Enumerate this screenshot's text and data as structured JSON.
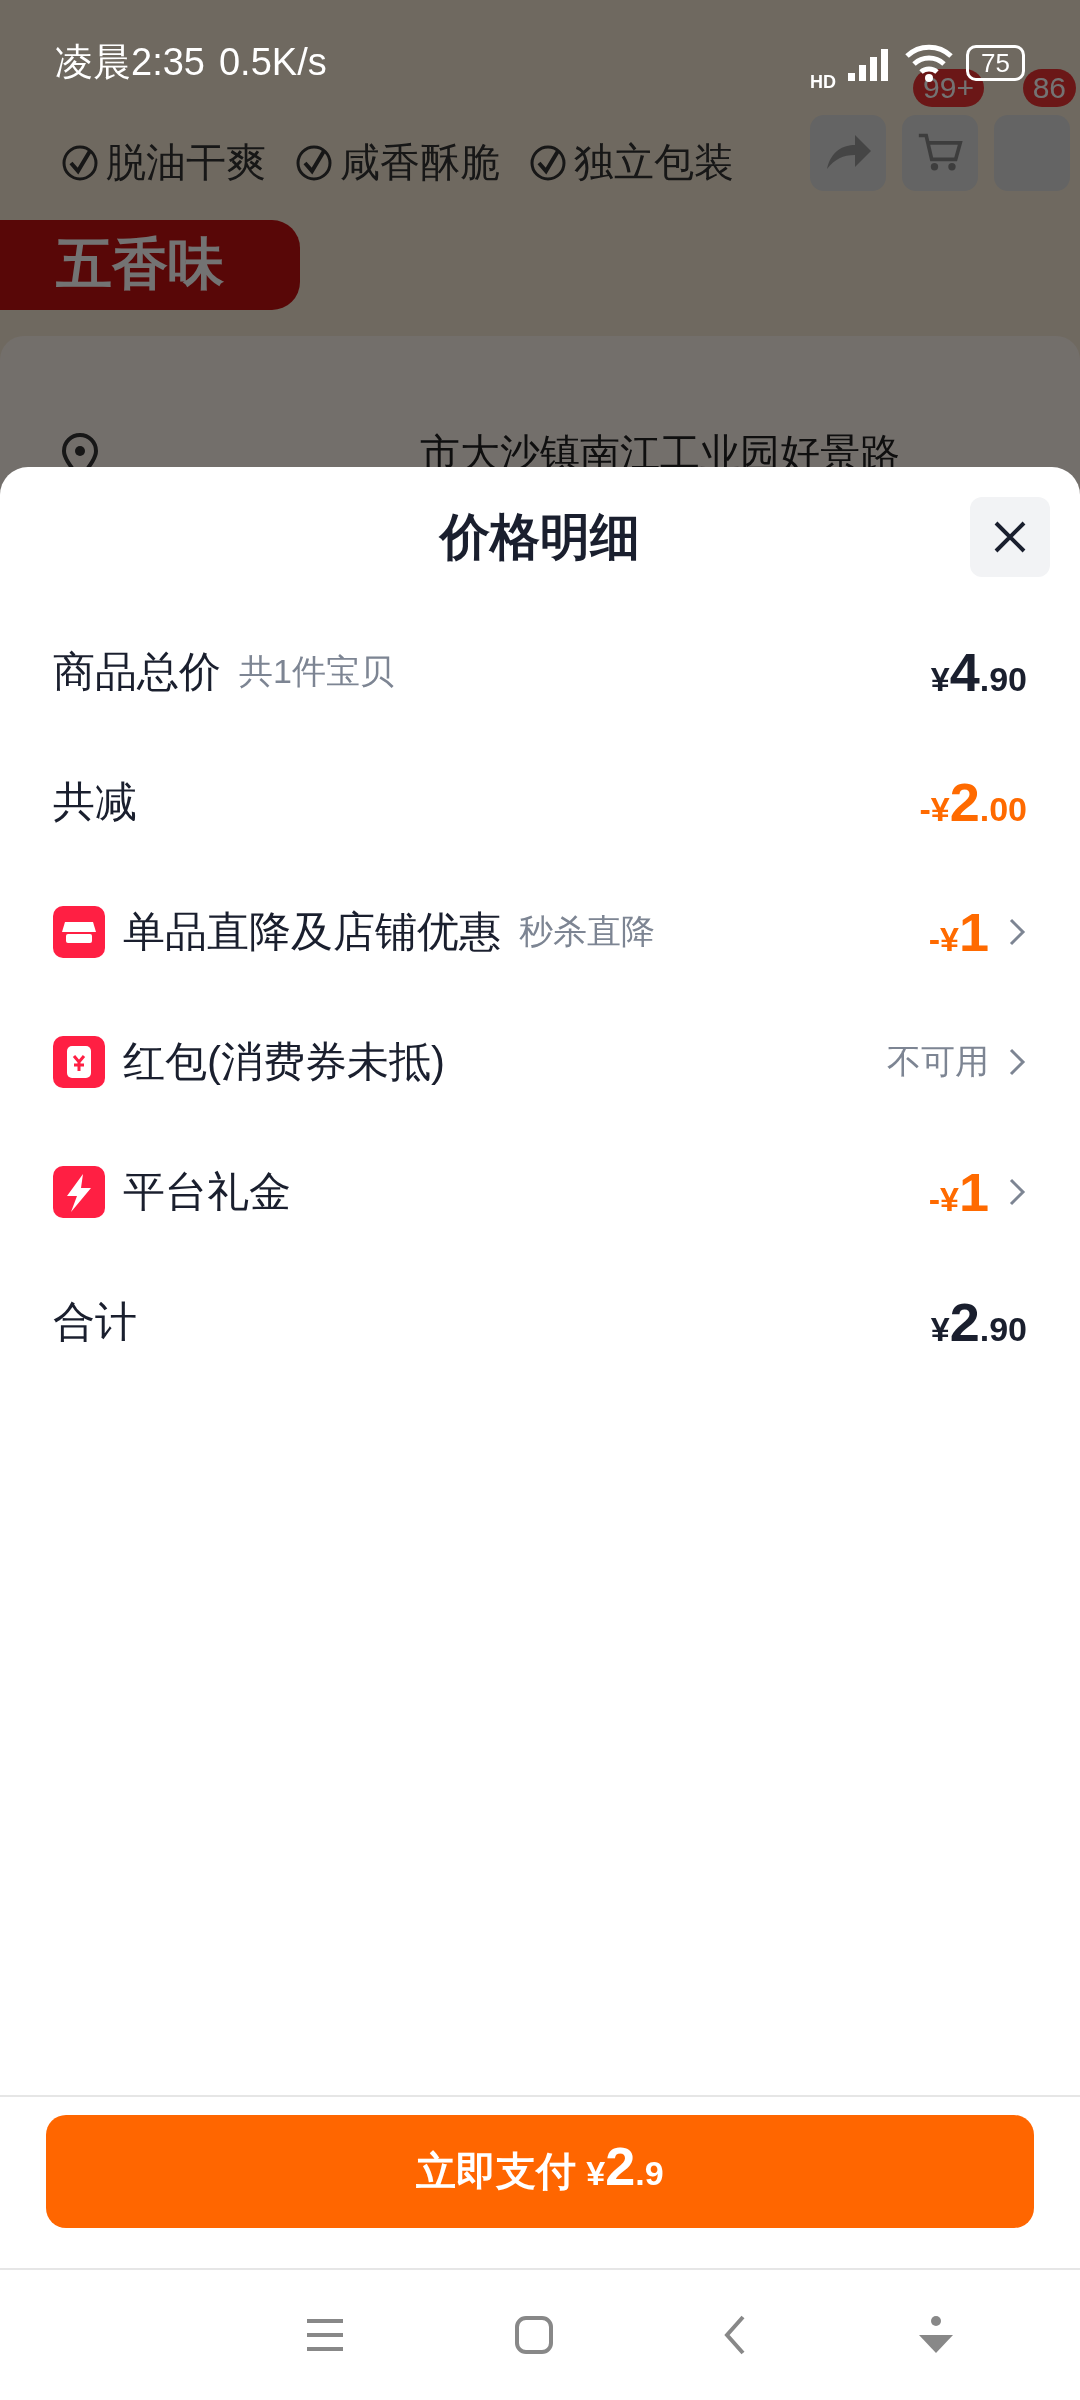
{
  "status_bar": {
    "time": "凌晨2:35",
    "speed": "0.5K/s",
    "network": "HD",
    "battery": "75"
  },
  "background_page": {
    "tags": [
      "脱油干爽",
      "咸香酥脆",
      "独立包装"
    ],
    "flavor_badge": "五香味",
    "cart_count": "99+",
    "more_count": "86",
    "address": "市大沙镇南江工业园好景路"
  },
  "sheet": {
    "title": "价格明细",
    "rows": [
      {
        "kind": "summary",
        "label": "商品总价",
        "note": "共1件宝贝",
        "amount": {
          "prefix": "¥",
          "integer": "4",
          "decimal": ".90"
        },
        "highlight": false,
        "chevron": false
      },
      {
        "kind": "summary",
        "label": "共减",
        "amount": {
          "prefix": "-¥",
          "integer": "2",
          "decimal": ".00"
        },
        "highlight": true,
        "chevron": false
      },
      {
        "kind": "discount",
        "label": "单品直降及店铺优惠",
        "note": "秒杀直降",
        "amount": {
          "prefix": "-¥",
          "integer": "1"
        },
        "highlight": true,
        "chevron": true
      },
      {
        "kind": "discount",
        "label": "红包(消费券未抵)",
        "status": "不可用",
        "chevron": true
      },
      {
        "kind": "discount",
        "label": "平台礼金",
        "amount": {
          "prefix": "-¥",
          "integer": "1"
        },
        "highlight": true,
        "chevron": true
      },
      {
        "kind": "summary",
        "label": "合计",
        "amount": {
          "prefix": "¥",
          "integer": "2",
          "decimal": ".90"
        },
        "highlight": false,
        "chevron": false
      }
    ]
  },
  "pay_button": {
    "label": "立即支付",
    "prefix": "¥",
    "integer": "2",
    "decimal": ".9"
  }
}
